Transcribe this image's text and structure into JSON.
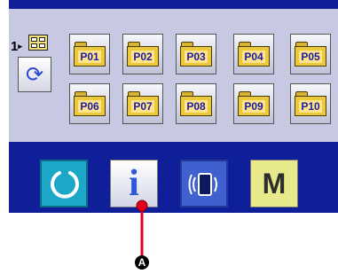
{
  "list_indicator": {
    "number": "1",
    "arrow": "▸"
  },
  "patterns": {
    "row1": [
      "P01",
      "P02",
      "P03",
      "P04",
      "P05"
    ],
    "row2": [
      "P06",
      "P07",
      "P08",
      "P09",
      "P10"
    ]
  },
  "footer": {
    "mode_label": "M",
    "info_glyph": "i"
  },
  "callout": {
    "label": "A"
  },
  "colors": {
    "frame_blue": "#0f1f9a",
    "panel_lavender": "#c7c9e3",
    "reset_cyan": "#1ba8c8",
    "comm_blue": "#3f61cf",
    "mode_yellow": "#e7e98a",
    "folder_gold": "#ecc93c",
    "pointer_red": "#e0001b"
  },
  "icons": {
    "list_grid": "grid-icon",
    "refresh": "refresh-icon",
    "folder": "folder-icon",
    "reset": "reset-icon",
    "info": "info-icon",
    "communication": "communication-icon"
  }
}
